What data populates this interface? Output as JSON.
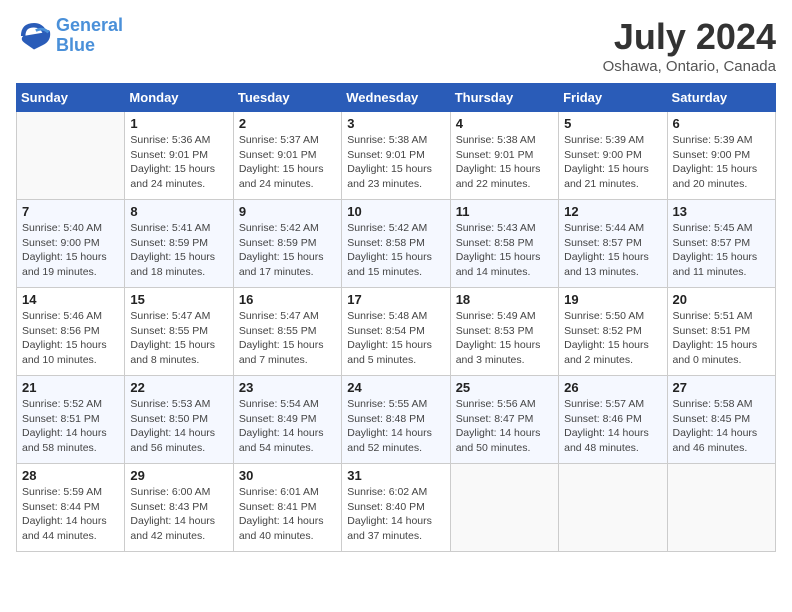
{
  "header": {
    "logo_line1": "General",
    "logo_line2": "Blue",
    "month": "July 2024",
    "location": "Oshawa, Ontario, Canada"
  },
  "days_of_week": [
    "Sunday",
    "Monday",
    "Tuesday",
    "Wednesday",
    "Thursday",
    "Friday",
    "Saturday"
  ],
  "weeks": [
    [
      {
        "day": "",
        "info": ""
      },
      {
        "day": "1",
        "info": "Sunrise: 5:36 AM\nSunset: 9:01 PM\nDaylight: 15 hours\nand 24 minutes."
      },
      {
        "day": "2",
        "info": "Sunrise: 5:37 AM\nSunset: 9:01 PM\nDaylight: 15 hours\nand 24 minutes."
      },
      {
        "day": "3",
        "info": "Sunrise: 5:38 AM\nSunset: 9:01 PM\nDaylight: 15 hours\nand 23 minutes."
      },
      {
        "day": "4",
        "info": "Sunrise: 5:38 AM\nSunset: 9:01 PM\nDaylight: 15 hours\nand 22 minutes."
      },
      {
        "day": "5",
        "info": "Sunrise: 5:39 AM\nSunset: 9:00 PM\nDaylight: 15 hours\nand 21 minutes."
      },
      {
        "day": "6",
        "info": "Sunrise: 5:39 AM\nSunset: 9:00 PM\nDaylight: 15 hours\nand 20 minutes."
      }
    ],
    [
      {
        "day": "7",
        "info": "Sunrise: 5:40 AM\nSunset: 9:00 PM\nDaylight: 15 hours\nand 19 minutes."
      },
      {
        "day": "8",
        "info": "Sunrise: 5:41 AM\nSunset: 8:59 PM\nDaylight: 15 hours\nand 18 minutes."
      },
      {
        "day": "9",
        "info": "Sunrise: 5:42 AM\nSunset: 8:59 PM\nDaylight: 15 hours\nand 17 minutes."
      },
      {
        "day": "10",
        "info": "Sunrise: 5:42 AM\nSunset: 8:58 PM\nDaylight: 15 hours\nand 15 minutes."
      },
      {
        "day": "11",
        "info": "Sunrise: 5:43 AM\nSunset: 8:58 PM\nDaylight: 15 hours\nand 14 minutes."
      },
      {
        "day": "12",
        "info": "Sunrise: 5:44 AM\nSunset: 8:57 PM\nDaylight: 15 hours\nand 13 minutes."
      },
      {
        "day": "13",
        "info": "Sunrise: 5:45 AM\nSunset: 8:57 PM\nDaylight: 15 hours\nand 11 minutes."
      }
    ],
    [
      {
        "day": "14",
        "info": "Sunrise: 5:46 AM\nSunset: 8:56 PM\nDaylight: 15 hours\nand 10 minutes."
      },
      {
        "day": "15",
        "info": "Sunrise: 5:47 AM\nSunset: 8:55 PM\nDaylight: 15 hours\nand 8 minutes."
      },
      {
        "day": "16",
        "info": "Sunrise: 5:47 AM\nSunset: 8:55 PM\nDaylight: 15 hours\nand 7 minutes."
      },
      {
        "day": "17",
        "info": "Sunrise: 5:48 AM\nSunset: 8:54 PM\nDaylight: 15 hours\nand 5 minutes."
      },
      {
        "day": "18",
        "info": "Sunrise: 5:49 AM\nSunset: 8:53 PM\nDaylight: 15 hours\nand 3 minutes."
      },
      {
        "day": "19",
        "info": "Sunrise: 5:50 AM\nSunset: 8:52 PM\nDaylight: 15 hours\nand 2 minutes."
      },
      {
        "day": "20",
        "info": "Sunrise: 5:51 AM\nSunset: 8:51 PM\nDaylight: 15 hours\nand 0 minutes."
      }
    ],
    [
      {
        "day": "21",
        "info": "Sunrise: 5:52 AM\nSunset: 8:51 PM\nDaylight: 14 hours\nand 58 minutes."
      },
      {
        "day": "22",
        "info": "Sunrise: 5:53 AM\nSunset: 8:50 PM\nDaylight: 14 hours\nand 56 minutes."
      },
      {
        "day": "23",
        "info": "Sunrise: 5:54 AM\nSunset: 8:49 PM\nDaylight: 14 hours\nand 54 minutes."
      },
      {
        "day": "24",
        "info": "Sunrise: 5:55 AM\nSunset: 8:48 PM\nDaylight: 14 hours\nand 52 minutes."
      },
      {
        "day": "25",
        "info": "Sunrise: 5:56 AM\nSunset: 8:47 PM\nDaylight: 14 hours\nand 50 minutes."
      },
      {
        "day": "26",
        "info": "Sunrise: 5:57 AM\nSunset: 8:46 PM\nDaylight: 14 hours\nand 48 minutes."
      },
      {
        "day": "27",
        "info": "Sunrise: 5:58 AM\nSunset: 8:45 PM\nDaylight: 14 hours\nand 46 minutes."
      }
    ],
    [
      {
        "day": "28",
        "info": "Sunrise: 5:59 AM\nSunset: 8:44 PM\nDaylight: 14 hours\nand 44 minutes."
      },
      {
        "day": "29",
        "info": "Sunrise: 6:00 AM\nSunset: 8:43 PM\nDaylight: 14 hours\nand 42 minutes."
      },
      {
        "day": "30",
        "info": "Sunrise: 6:01 AM\nSunset: 8:41 PM\nDaylight: 14 hours\nand 40 minutes."
      },
      {
        "day": "31",
        "info": "Sunrise: 6:02 AM\nSunset: 8:40 PM\nDaylight: 14 hours\nand 37 minutes."
      },
      {
        "day": "",
        "info": ""
      },
      {
        "day": "",
        "info": ""
      },
      {
        "day": "",
        "info": ""
      }
    ]
  ]
}
